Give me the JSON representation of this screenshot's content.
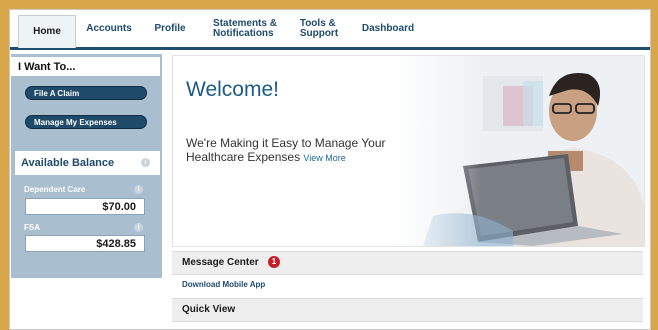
{
  "nav": {
    "tabs": [
      {
        "label": "Home"
      },
      {
        "label": "Accounts"
      },
      {
        "label": "Profile"
      },
      {
        "label_line1": "Statements &",
        "label_line2": "Notifications"
      },
      {
        "label_line1": "Tools &",
        "label_line2": "Support"
      },
      {
        "label": "Dashboard"
      }
    ]
  },
  "sidebar": {
    "heading": "I Want To...",
    "actions": [
      "File A Claim",
      "Manage My Expenses"
    ],
    "available_balance": {
      "title": "Available Balance",
      "accounts": [
        {
          "label": "Dependent Care",
          "amount": "$70.00"
        },
        {
          "label": "FSA",
          "amount": "$428.85"
        }
      ]
    }
  },
  "hero": {
    "title": "Welcome!",
    "tagline": "We're Making it Easy to Manage Your Healthcare Expenses",
    "view_more": "View More"
  },
  "message_center": {
    "title": "Message Center",
    "badge_count": "1"
  },
  "download_link": "Download Mobile App",
  "quick_view": {
    "title": "Quick View"
  },
  "colors": {
    "primary": "#1f4a6a",
    "sidebar": "#a9bfd0",
    "accent_red": "#c41e2a",
    "frame": "#d9a64a"
  }
}
